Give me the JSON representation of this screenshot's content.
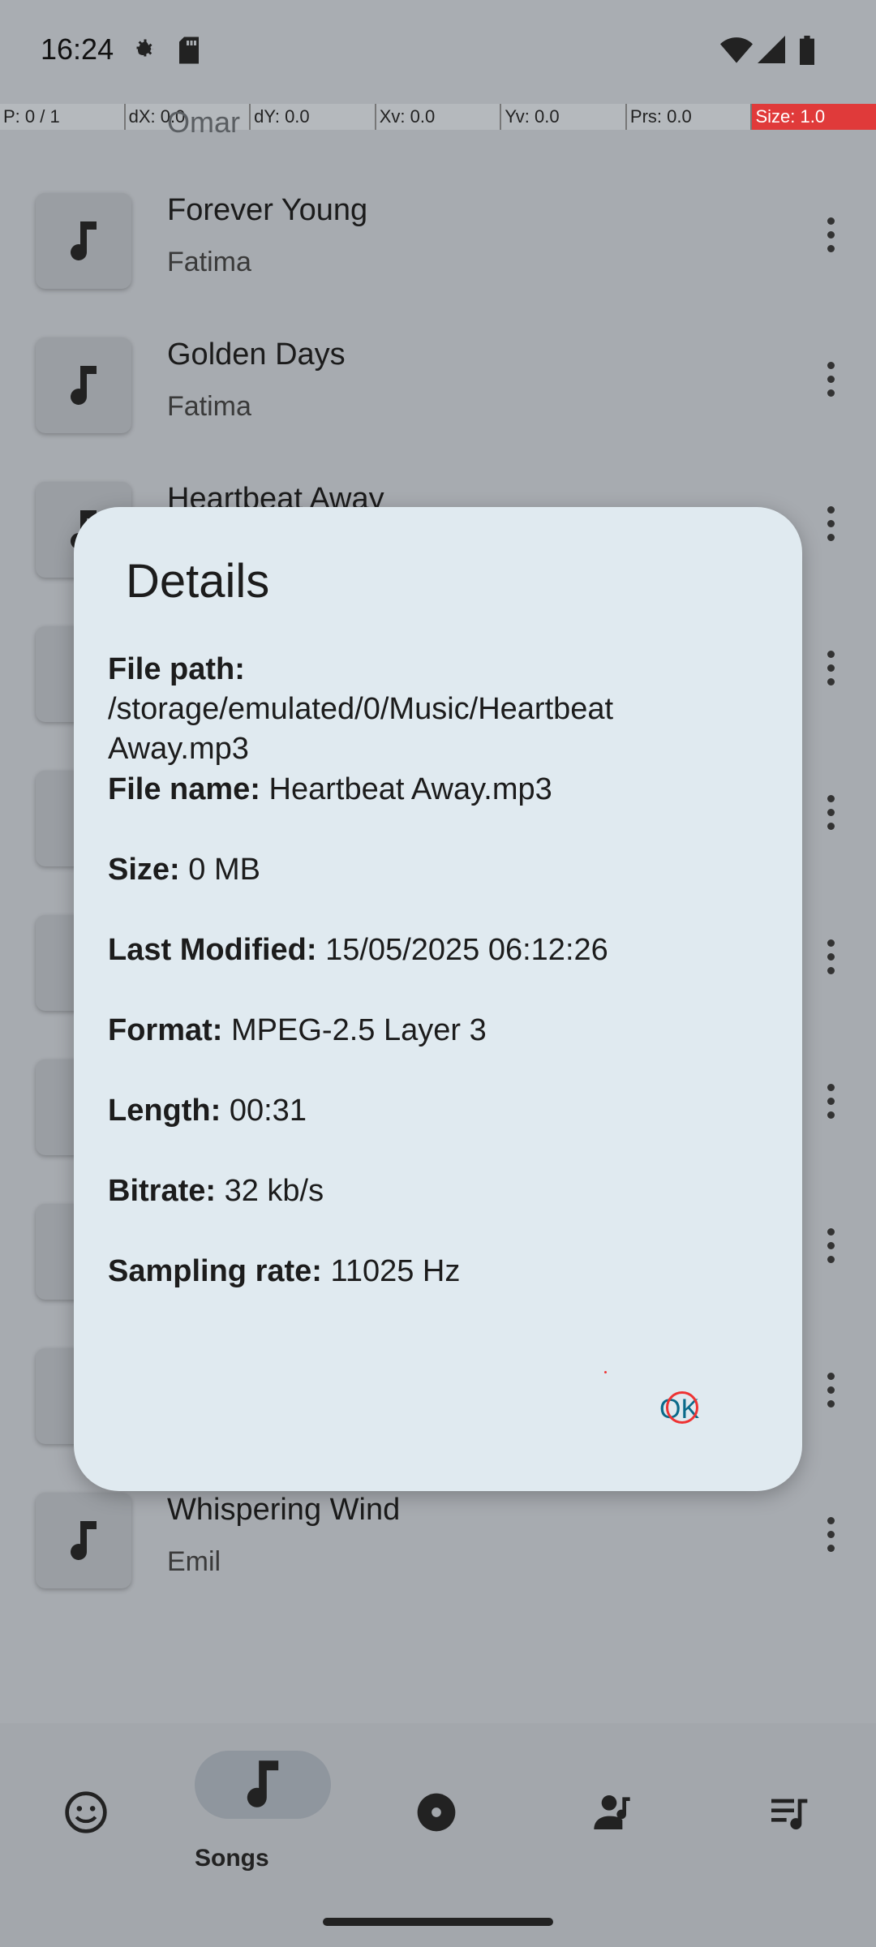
{
  "status": {
    "time": "16:24"
  },
  "debug": [
    "P: 0 / 1",
    "dX: 0.0",
    "dY: 0.0",
    "Xv: 0.0",
    "Yv: 0.0",
    "Prs: 0.0",
    "Size: 1.0"
  ],
  "list": {
    "top_partial": "Omar",
    "rows": [
      {
        "title": "Forever Young",
        "artist": "Fatima"
      },
      {
        "title": "Golden Days",
        "artist": "Fatima"
      },
      {
        "title": "Heartbeat Away",
        "artist": ""
      },
      {
        "title": "",
        "artist": ""
      },
      {
        "title": "",
        "artist": ""
      },
      {
        "title": "",
        "artist": ""
      },
      {
        "title": "",
        "artist": ""
      },
      {
        "title": "",
        "artist": ""
      },
      {
        "title": "",
        "artist": ""
      },
      {
        "title": "Whispering Wind",
        "artist": "Emil"
      }
    ]
  },
  "dialog": {
    "title": "Details",
    "items": [
      {
        "label": "File path:",
        "value": "/storage/emulated/0/Music/Heartbeat Away.mp3"
      },
      {
        "label": "File name:",
        "value": "Heartbeat Away.mp3"
      },
      {
        "label": "Size:",
        "value": "0 MB"
      },
      {
        "label": "Last Modified:",
        "value": "15/05/2025 06:12:26"
      },
      {
        "label": "Format:",
        "value": "MPEG-2.5 Layer 3"
      },
      {
        "label": "Length:",
        "value": "00:31"
      },
      {
        "label": "Bitrate:",
        "value": "32 kb/s"
      },
      {
        "label": "Sampling rate:",
        "value": "11025 Hz"
      }
    ],
    "ok_label": "OK"
  },
  "nav": {
    "active_label": "Songs"
  }
}
